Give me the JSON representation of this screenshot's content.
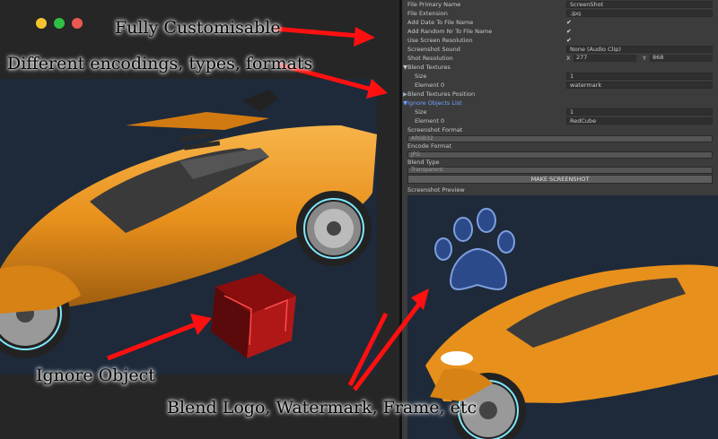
{
  "overlay": {
    "fully_customisable": "Fully Customisable",
    "encodings": "Different encodings, types, formats",
    "ignore_object": "Ignore Object",
    "blend_logo": "Blend Logo, Watermark, Frame, etc"
  },
  "colors": {
    "traffic_close": "#f4c430",
    "traffic_min": "#2fbf44",
    "traffic_max": "#e9594f",
    "car_orange": "#e8901c",
    "arrow_red": "#ff1010"
  },
  "inspector": {
    "file_primary_name": {
      "label": "File Primary Name",
      "value": "ScreenShot"
    },
    "file_extension": {
      "label": "File Extension",
      "value": ".jpg"
    },
    "add_date": {
      "label": "Add Date To File Name",
      "checked": "✔"
    },
    "add_random": {
      "label": "Add Random Nr To File Name",
      "checked": "✔"
    },
    "use_screen_res": {
      "label": "Use Screen Resolution",
      "checked": "✔"
    },
    "screenshot_sound": {
      "label": "Screenshot Sound",
      "value": "None (Audio Clip)"
    },
    "shot_resolution": {
      "label": "Shot Resolution",
      "x_label": "X",
      "x": "277",
      "y_label": "Y",
      "y": "868"
    },
    "blend_textures": {
      "label": "Blend Textures",
      "arrow": "▼"
    },
    "blend_size": {
      "label": "Size",
      "value": "1"
    },
    "blend_element0": {
      "label": "Element 0",
      "value": "watermark"
    },
    "blend_position": {
      "label": "Blend Textures Position",
      "arrow": "▶"
    },
    "ignore_list": {
      "label": "Ignore Objects List",
      "arrow": "▼"
    },
    "ignore_size": {
      "label": "Size",
      "value": "1"
    },
    "ignore_element0": {
      "label": "Element 0",
      "value": "RedCube"
    },
    "screenshot_format": {
      "label": "Screenshot Format",
      "value": "ARGB32"
    },
    "encode_format": {
      "label": "Encode Format",
      "value": "JPG"
    },
    "blend_type": {
      "label": "Blend Type",
      "value": "Transparent"
    },
    "make_button": "MAKE SCREENSHOT",
    "preview_label": "Screenshot Preview"
  }
}
